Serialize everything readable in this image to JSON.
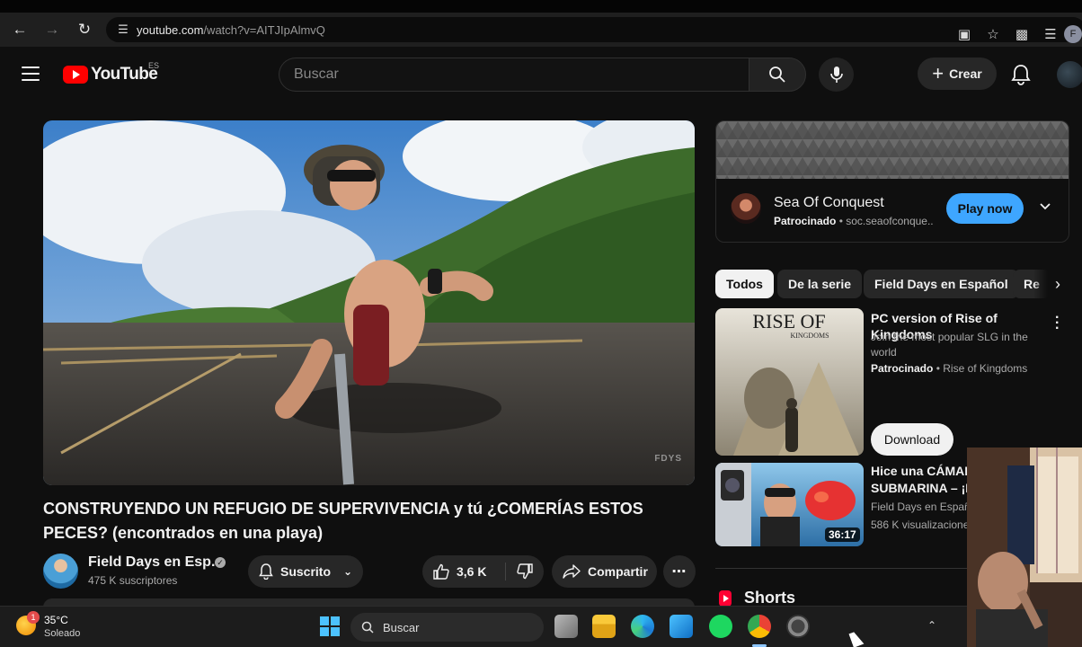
{
  "browser": {
    "url_host": "youtube.com",
    "url_path": "/watch?v=AITJIpAlmvQ",
    "profile_initial": "F"
  },
  "masthead": {
    "logo_text": "YouTube",
    "region": "ES",
    "search_placeholder": "Buscar",
    "create_label": "Crear"
  },
  "video": {
    "title": "CONSTRUYENDO UN REFUGIO DE SUPERVIVENCIA y tú ¿COMERÍAS ESTOS PECES? (encontrados en una playa)",
    "watermark": "FDYS",
    "channel_name": "Field Days en Esp...",
    "subscribers": "475 K suscriptores",
    "subscribed_label": "Suscrito",
    "likes": "3,6 K",
    "share_label": "Compartir"
  },
  "ad": {
    "title": "Sea Of Conquest",
    "sponsored": "Patrocinado",
    "domain": "soc.seaofconque...",
    "cta": "Play now"
  },
  "chips": [
    "Todos",
    "De la serie",
    "Field Days en Español",
    "Re"
  ],
  "sponsored_video": {
    "thumb_text_1": "RISE OF",
    "thumb_text_2": "KINGDOMS",
    "title": "PC version of Rise of Kingdoms",
    "description": "Join the most popular SLG in the world",
    "sponsored": "Patrocinado",
    "advertiser": "Rise of Kingdoms",
    "cta": "Download"
  },
  "related_video": {
    "title_line1": "Hice una CÁMARA",
    "title_line2": "SUBMARINA – ¡P",
    "channel": "Field Days en Españ",
    "views": "586 K visualizacione",
    "duration": "36:17"
  },
  "shorts_label": "Shorts",
  "taskbar": {
    "weather_temp": "35°C",
    "weather_condition": "Soleado",
    "weather_badge": "1",
    "search_label": "Buscar"
  },
  "colors": {
    "background": "#0f0f0f",
    "accent_blue": "#3ea6ff",
    "youtube_red": "#ff0000"
  }
}
